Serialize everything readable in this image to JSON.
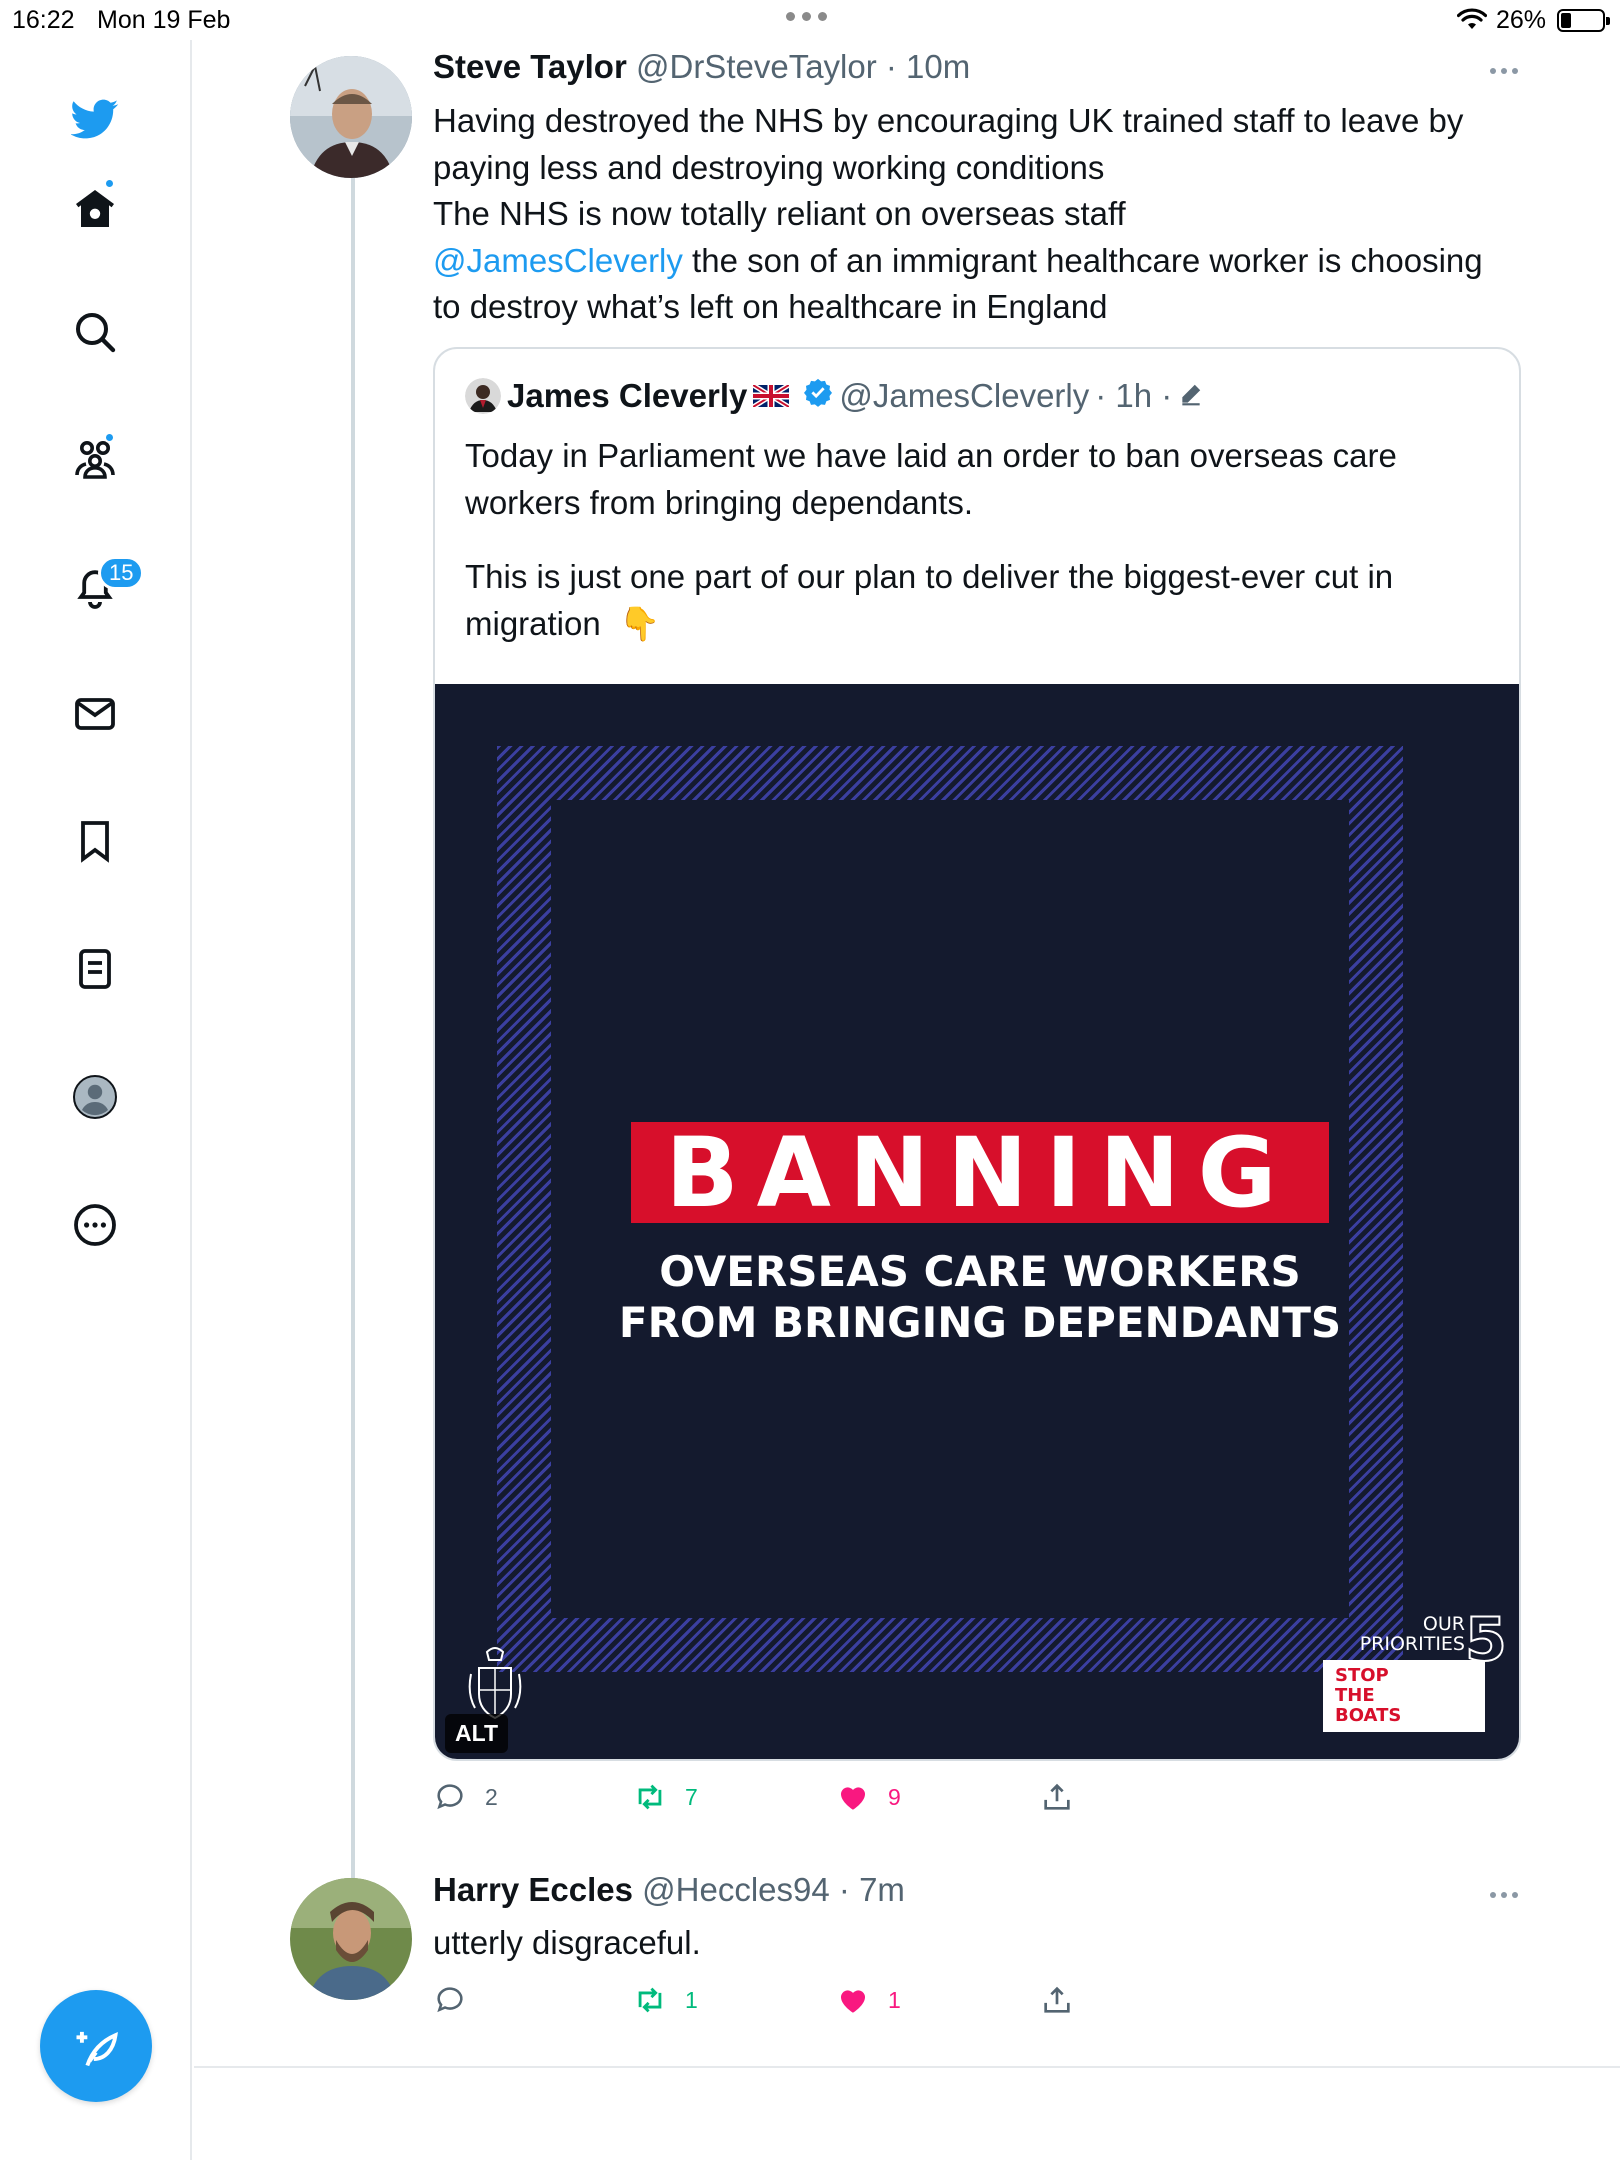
{
  "status_bar": {
    "time": "16:22",
    "date": "Mon 19 Feb",
    "battery": "26%",
    "battery_level": 0.26
  },
  "sidebar": {
    "items": [
      "Home",
      "Explore",
      "Communities",
      "Notifications",
      "Messages",
      "Bookmarks",
      "Lists",
      "Profile",
      "More"
    ],
    "notification_count": "15"
  },
  "tweet": {
    "name": "Steve Taylor",
    "handle": "@DrSteveTaylor",
    "time": "· 10m",
    "lines": [
      "Having destroyed the NHS by encouraging UK trained staff to leave by",
      "paying less and destroying working conditions",
      "The NHS is now totally reliant on overseas staff"
    ],
    "mention": "@JamesCleverly",
    "line4_rest": " the son of an immigrant healthcare worker is choosing",
    "line5": "to destroy what’s left on healthcare in England",
    "actions": {
      "replies": "2",
      "retweets": "7",
      "likes": "9"
    }
  },
  "quote": {
    "name": "James Cleverly",
    "flag": "🇬🇧",
    "handle": "@JamesCleverly",
    "time": "· 1h ·",
    "text1": "Today in Parliament we have laid an order to ban overseas care workers from bringing dependants.",
    "text2": "This is just one part of our plan to deliver the biggest-ever cut in migration",
    "emoji": "👇",
    "image": {
      "headline": "BANNING",
      "sub1": "OVERSEAS CARE WORKERS",
      "sub2": "FROM BRINGING DEPENDANTS",
      "priorities": "OUR PRIORITIES",
      "priority_number": "5",
      "priority_box": [
        "STOP",
        "THE",
        "BOATS"
      ],
      "alt": "ALT"
    }
  },
  "reply": {
    "name": "Harry Eccles",
    "handle": "@Heccles94",
    "time": "· 7m",
    "text": "utterly disgraceful.",
    "actions": {
      "replies": "",
      "retweets": "1",
      "likes": "1"
    }
  },
  "colors": {
    "accent": "#1d9bf0",
    "like": "#f91880",
    "retweet": "#00ba7c",
    "banner_red": "#d70f2b",
    "navy": "#141a2e"
  }
}
